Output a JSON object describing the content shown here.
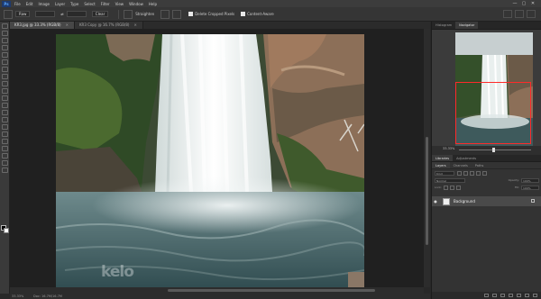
{
  "app": {
    "logo": "Ps",
    "menu": [
      "File",
      "Edit",
      "Image",
      "Layer",
      "Type",
      "Select",
      "Filter",
      "View",
      "Window",
      "Help"
    ],
    "window_controls": [
      "—",
      "▢",
      "✕"
    ]
  },
  "options_bar": {
    "size_label": "Size",
    "size_value": "Raw",
    "ratio_value": "Clear",
    "straighten_label": "Straighten",
    "delete_cropped_label": "Delete Cropped Pixels",
    "content_aware_label": "Content-Aware"
  },
  "tabs": [
    {
      "label": "KR3.jpg @ 33.3% (RGB/8)",
      "active": true
    },
    {
      "label": "KR3 Copy @ 16.7% (RGB/8)",
      "active": false
    }
  ],
  "status": {
    "zoom": "33.33%",
    "doc": "Doc: 16.7M/16.7M"
  },
  "watermark": "kelo",
  "navigator": {
    "tabs": [
      "Histogram",
      "Navigator"
    ],
    "zoom": "33.33%"
  },
  "layers_panel": {
    "tabs": [
      "Libraries",
      "Adjustments"
    ],
    "subtabs": [
      "Layers",
      "Channels",
      "Paths"
    ],
    "kind_label": "Kind",
    "blend_mode": "Normal",
    "opacity_label": "Opacity:",
    "opacity_value": "100%",
    "lock_label": "Lock:",
    "fill_label": "Fill:",
    "fill_value": "100%",
    "layer_name": "Background"
  },
  "colors": {
    "selection_rect": "#ff2a2a",
    "accent": "#5aa7ff"
  }
}
